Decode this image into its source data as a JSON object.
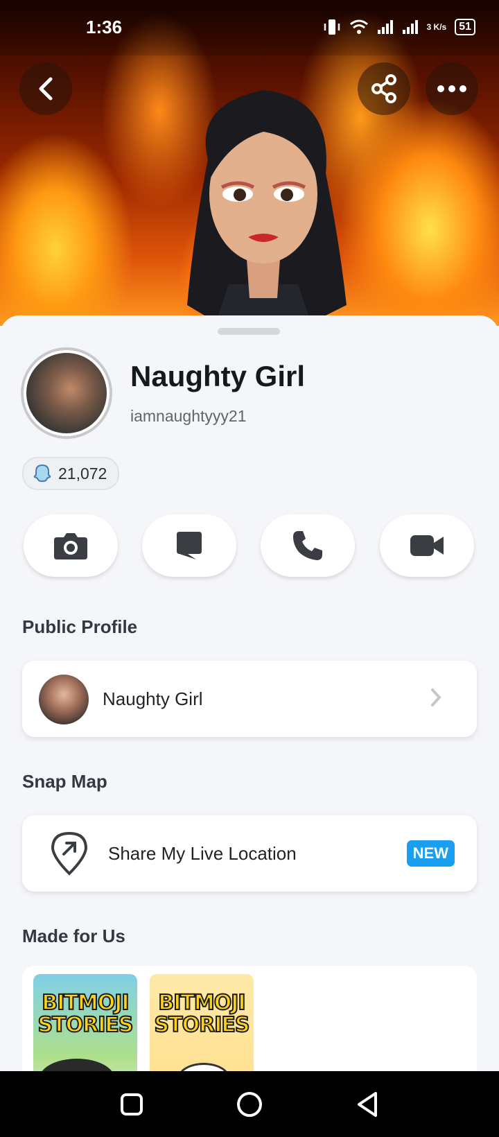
{
  "status_bar": {
    "time": "1:36",
    "network_speed": "3 K/s",
    "battery": "51"
  },
  "header": {
    "back_icon": "chevron-left-icon",
    "share_icon": "share-icon",
    "more_icon": "more-horizontal-icon"
  },
  "profile": {
    "display_name": "Naughty Girl",
    "username": "iamnaughtyyy21",
    "snap_score": "21,072"
  },
  "actions": [
    {
      "name": "camera",
      "icon": "camera-icon"
    },
    {
      "name": "chat",
      "icon": "chat-icon"
    },
    {
      "name": "voice-call",
      "icon": "phone-icon"
    },
    {
      "name": "video-call",
      "icon": "video-camera-icon"
    }
  ],
  "public_profile": {
    "section_title": "Public Profile",
    "name": "Naughty Girl"
  },
  "snap_map": {
    "section_title": "Snap Map",
    "label": "Share My Live Location",
    "badge": "NEW"
  },
  "made_for_us": {
    "section_title": "Made for Us",
    "tiles": [
      {
        "title_line1": "BITMOJI",
        "title_line2": "STORIES"
      },
      {
        "title_line1": "BITMOJI",
        "title_line2": "STORIES"
      }
    ]
  },
  "colors": {
    "accent_blue": "#1a9ef0",
    "background": "#f5f6fa",
    "text_dark": "#16191c"
  }
}
